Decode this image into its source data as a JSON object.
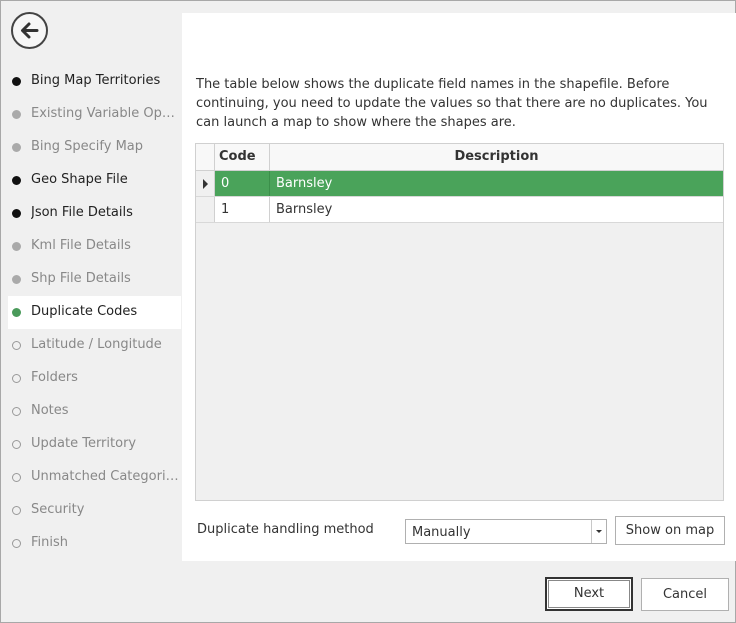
{
  "nav": {
    "items": [
      {
        "label": "Bing Map Territories",
        "state": "done"
      },
      {
        "label": "Existing Variable Options",
        "state": "skipped"
      },
      {
        "label": "Bing Specify Map",
        "state": "skipped"
      },
      {
        "label": "Geo Shape File",
        "state": "done"
      },
      {
        "label": "Json File Details",
        "state": "done"
      },
      {
        "label": "Kml File Details",
        "state": "skipped"
      },
      {
        "label": "Shp File Details",
        "state": "skipped"
      },
      {
        "label": "Duplicate Codes",
        "state": "current"
      },
      {
        "label": "Latitude / Longitude",
        "state": "todo"
      },
      {
        "label": "Folders",
        "state": "todo"
      },
      {
        "label": "Notes",
        "state": "todo"
      },
      {
        "label": "Update Territory",
        "state": "todo"
      },
      {
        "label": "Unmatched Categories",
        "state": "todo"
      },
      {
        "label": "Security",
        "state": "todo"
      },
      {
        "label": "Finish",
        "state": "todo"
      }
    ]
  },
  "main": {
    "description": "The table below shows the duplicate field names in the shapefile. Before continuing, you need to update the values so that there are no duplicates. You can launch a map to show where the shapes are.",
    "table": {
      "columns": [
        "Code",
        "Description"
      ],
      "rows": [
        {
          "code": "0",
          "description": "Barnsley",
          "selected": true
        },
        {
          "code": "1",
          "description": "Barnsley",
          "selected": false
        }
      ]
    },
    "method_label": "Duplicate handling method",
    "method_value": "Manually",
    "show_map_label": "Show on map"
  },
  "footer": {
    "next_label": "Next",
    "cancel_label": "Cancel"
  },
  "colors": {
    "accent": "#4aa35a",
    "current_dot": "#4a9a5a"
  },
  "icons": {
    "back": "arrow-left-icon",
    "row_indicator": "triangle-right-icon",
    "dropdown": "chevron-down-icon"
  }
}
